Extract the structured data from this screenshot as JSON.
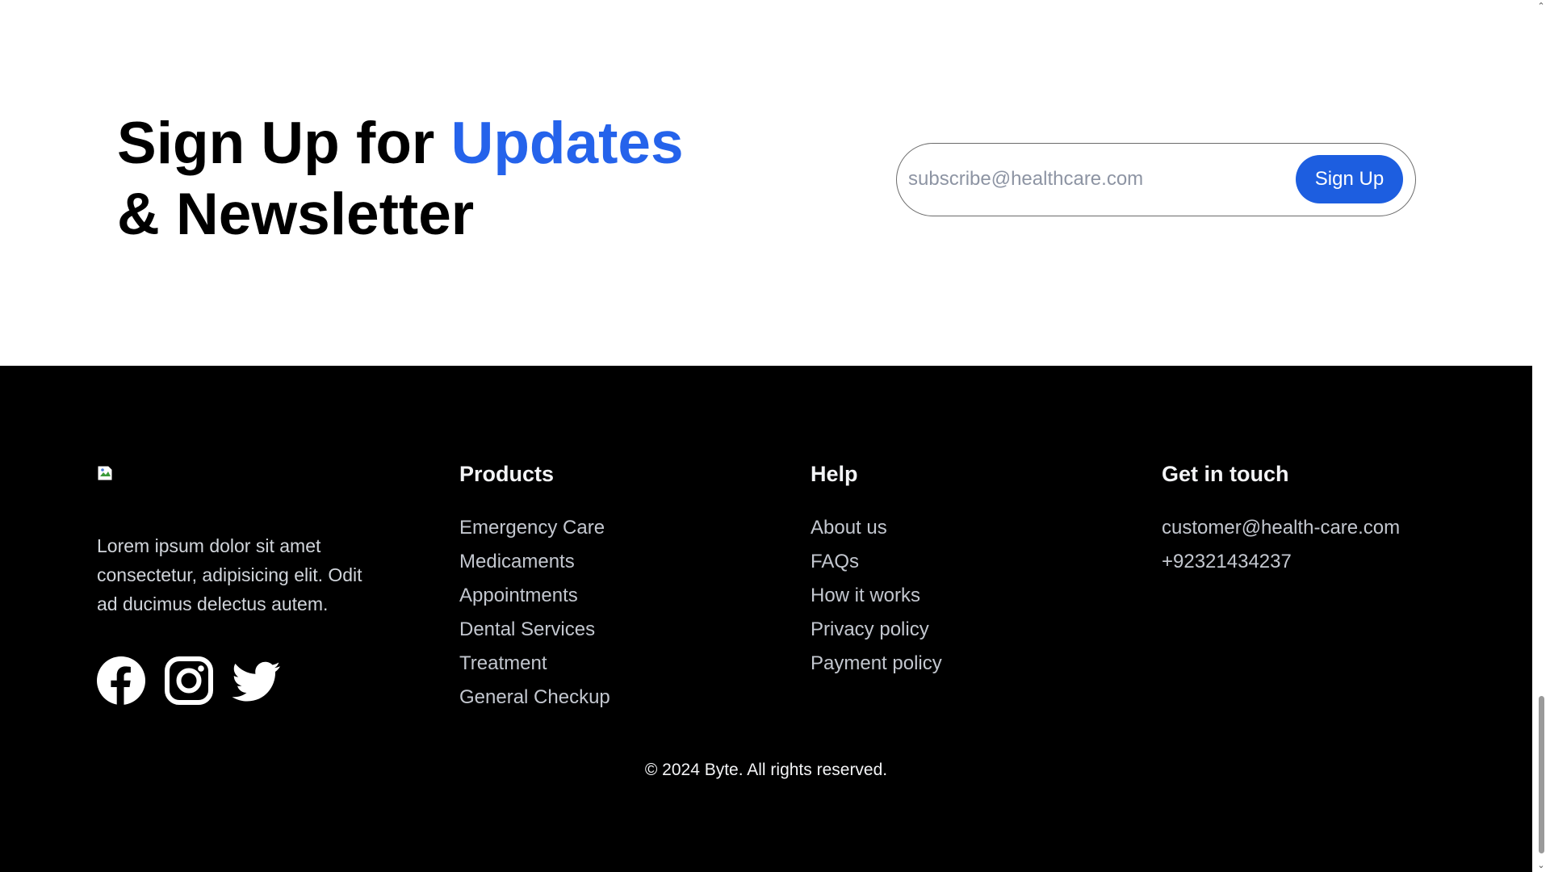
{
  "signup": {
    "title_part1": "Sign Up for ",
    "title_accent": "Updates",
    "title_line2": "& Newsletter",
    "input_placeholder": "subscribe@healthcare.com",
    "button_label": "Sign Up",
    "accent_color": "#2563eb",
    "button_color": "#1d5ee0"
  },
  "footer": {
    "about_text": "Lorem ipsum dolor sit amet consectetur, adipisicing elit. Odit ad ducimus delectus autem.",
    "social": [
      "facebook-icon",
      "instagram-icon",
      "twitter-icon"
    ],
    "products": {
      "heading": "Products",
      "items": [
        "Emergency Care",
        "Medicaments",
        "Appointments",
        "Dental Services",
        "Treatment",
        "General Checkup"
      ]
    },
    "help": {
      "heading": "Help",
      "items": [
        "About us",
        "FAQs",
        "How it works",
        "Privacy policy",
        "Payment policy"
      ]
    },
    "contact": {
      "heading": "Get in touch",
      "email": "customer@health-care.com",
      "phone": "+92321434237"
    },
    "copyright": "© 2024 Byte. All rights reserved."
  },
  "scrollbar": {
    "up_glyph": "⌃",
    "down_glyph": "⌄"
  }
}
